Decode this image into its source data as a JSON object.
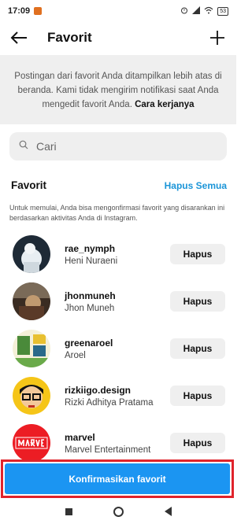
{
  "status_bar": {
    "time": "17:09",
    "battery": "53"
  },
  "header": {
    "title": "Favorit",
    "back_icon": "arrow-left-icon",
    "add_icon": "plus-icon"
  },
  "info": {
    "text": "Postingan dari favorit Anda ditampilkan lebih atas di beranda. Kami tidak mengirim notifikasi saat Anda mengedit favorit Anda.",
    "link": "Cara kerjanya"
  },
  "search": {
    "placeholder": "Cari",
    "icon": "search-icon"
  },
  "section": {
    "title": "Favorit",
    "action": "Hapus Semua",
    "description": "Untuk memulai, Anda bisa mengonfirmasi favorit yang disarankan ini berdasarkan aktivitas Anda di Instagram."
  },
  "favorites": [
    {
      "username": "rae_nymph",
      "name": "Heni Nuraeni",
      "button": "Hapus"
    },
    {
      "username": "jhonmuneh",
      "name": "Jhon Muneh",
      "button": "Hapus"
    },
    {
      "username": "greenaroel",
      "name": "Aroel",
      "button": "Hapus"
    },
    {
      "username": "rizkiigo.design",
      "name": "Rizki Adhitya Pratama",
      "button": "Hapus"
    },
    {
      "username": "marvel",
      "name": "Marvel Entertainment",
      "button": "Hapus"
    }
  ],
  "confirm": {
    "label": "Konfirmasikan favorit"
  },
  "colors": {
    "accent": "#1b95f2",
    "link": "#1b95d8",
    "highlight": "#e0232b"
  }
}
